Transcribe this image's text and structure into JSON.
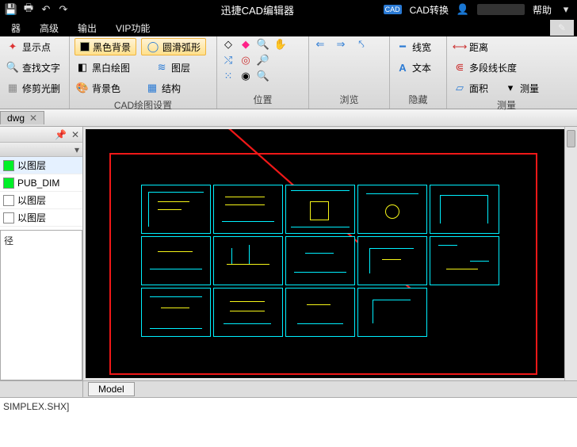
{
  "titlebar": {
    "title": "迅捷CAD编辑器",
    "cad_convert": "CAD转换",
    "help": "帮助"
  },
  "menu": {
    "item0": "器",
    "item1": "高级",
    "item2": "输出",
    "item3": "VIP功能"
  },
  "ribbon": {
    "g1": {
      "show_points": "显示点",
      "find_text": "查找文字",
      "trim": "修剪光删"
    },
    "g2": {
      "black_bg": "黑色背景",
      "smooth_arc": "圆滑弧形",
      "bw_draw": "黑白绘图",
      "layers": "图层",
      "bg_color": "背景色",
      "structure": "结构",
      "title": "CAD绘图设置"
    },
    "g3": {
      "title": "位置"
    },
    "g4": {
      "title": "浏览"
    },
    "g5": {
      "line_width": "线宽",
      "text": "文本",
      "title": "隐藏"
    },
    "g6": {
      "distance": "距离",
      "poly_len": "多段线长度",
      "area": "面积",
      "measure": "测量",
      "title": "测量"
    }
  },
  "doctab": {
    "name": "dwg"
  },
  "layers": {
    "row0": {
      "name": "以图层",
      "color": "#00f028"
    },
    "row1": {
      "name": "PUB_DIM",
      "color": "#00f028"
    },
    "row2": {
      "name": "以图层",
      "color": "#ffffff"
    },
    "row3": {
      "name": "以图层",
      "color": "#ffffff"
    }
  },
  "shx": {
    "text": "径"
  },
  "model": {
    "tab": "Model"
  },
  "status": {
    "text": "SIMPLEX.SHX]"
  }
}
